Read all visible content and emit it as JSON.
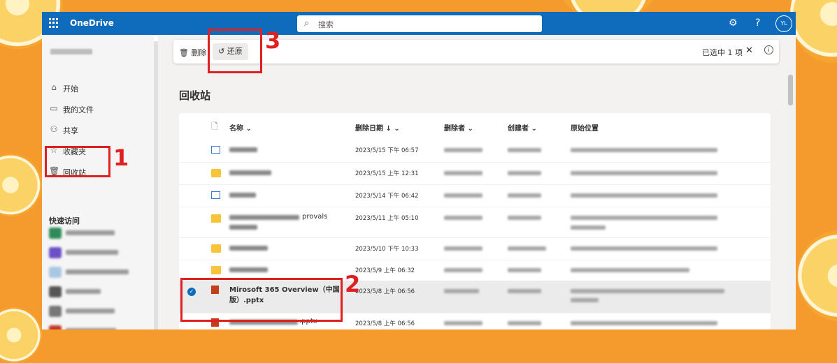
{
  "topbar": {
    "app_name": "OneDrive",
    "search_placeholder": "搜索",
    "avatar_initials": "YL",
    "help_label": "?"
  },
  "sidebar": {
    "nav": [
      {
        "label": "开始",
        "icon": "home-icon"
      },
      {
        "label": "我的文件",
        "icon": "folder-icon"
      },
      {
        "label": "共享",
        "icon": "people-icon"
      },
      {
        "label": "收藏夹",
        "icon": "star-icon"
      },
      {
        "label": "回收站",
        "icon": "trash-icon"
      }
    ],
    "quick_access_title": "快速访问"
  },
  "command_bar": {
    "delete_label": "删除",
    "restore_label": "还原",
    "selection_text": "已选中 1 项"
  },
  "page": {
    "title": "回收站"
  },
  "table": {
    "columns": {
      "name": "名称",
      "deleted_date": "删除日期",
      "deleted_by": "删除者",
      "created_by": "创建者",
      "original_location": "原始位置"
    },
    "rows": [
      {
        "type": "image",
        "name_partial": "",
        "date": "2023/5/15 下午 06:57",
        "selected": false
      },
      {
        "type": "folder",
        "name_partial": "",
        "date": "2023/5/15 上午 12:31",
        "selected": false
      },
      {
        "type": "image",
        "name_partial": "",
        "date": "2023/5/14 下午 06:42",
        "selected": false
      },
      {
        "type": "folder",
        "name_partial": "provals",
        "date": "2023/5/11 上午 05:10",
        "selected": false
      },
      {
        "type": "folder",
        "name_partial": "",
        "date": "2023/5/10 下午 10:33",
        "selected": false
      },
      {
        "type": "folder",
        "name_partial": "",
        "date": "2023/5/9 上午 06:32",
        "selected": false
      },
      {
        "type": "pptx",
        "name": "Mirosoft 365 Overview（中国版）.pptx",
        "date": "2023/5/8 上午 06:56",
        "selected": true
      },
      {
        "type": "pptx",
        "name_partial": ".pptx",
        "date": "2023/5/8 上午 06:56",
        "selected": false
      }
    ]
  },
  "annotations": [
    "1",
    "2",
    "3"
  ],
  "colors": {
    "brand": "#0f6cbd",
    "annotation": "#e02020",
    "background": "#f59a2c"
  }
}
